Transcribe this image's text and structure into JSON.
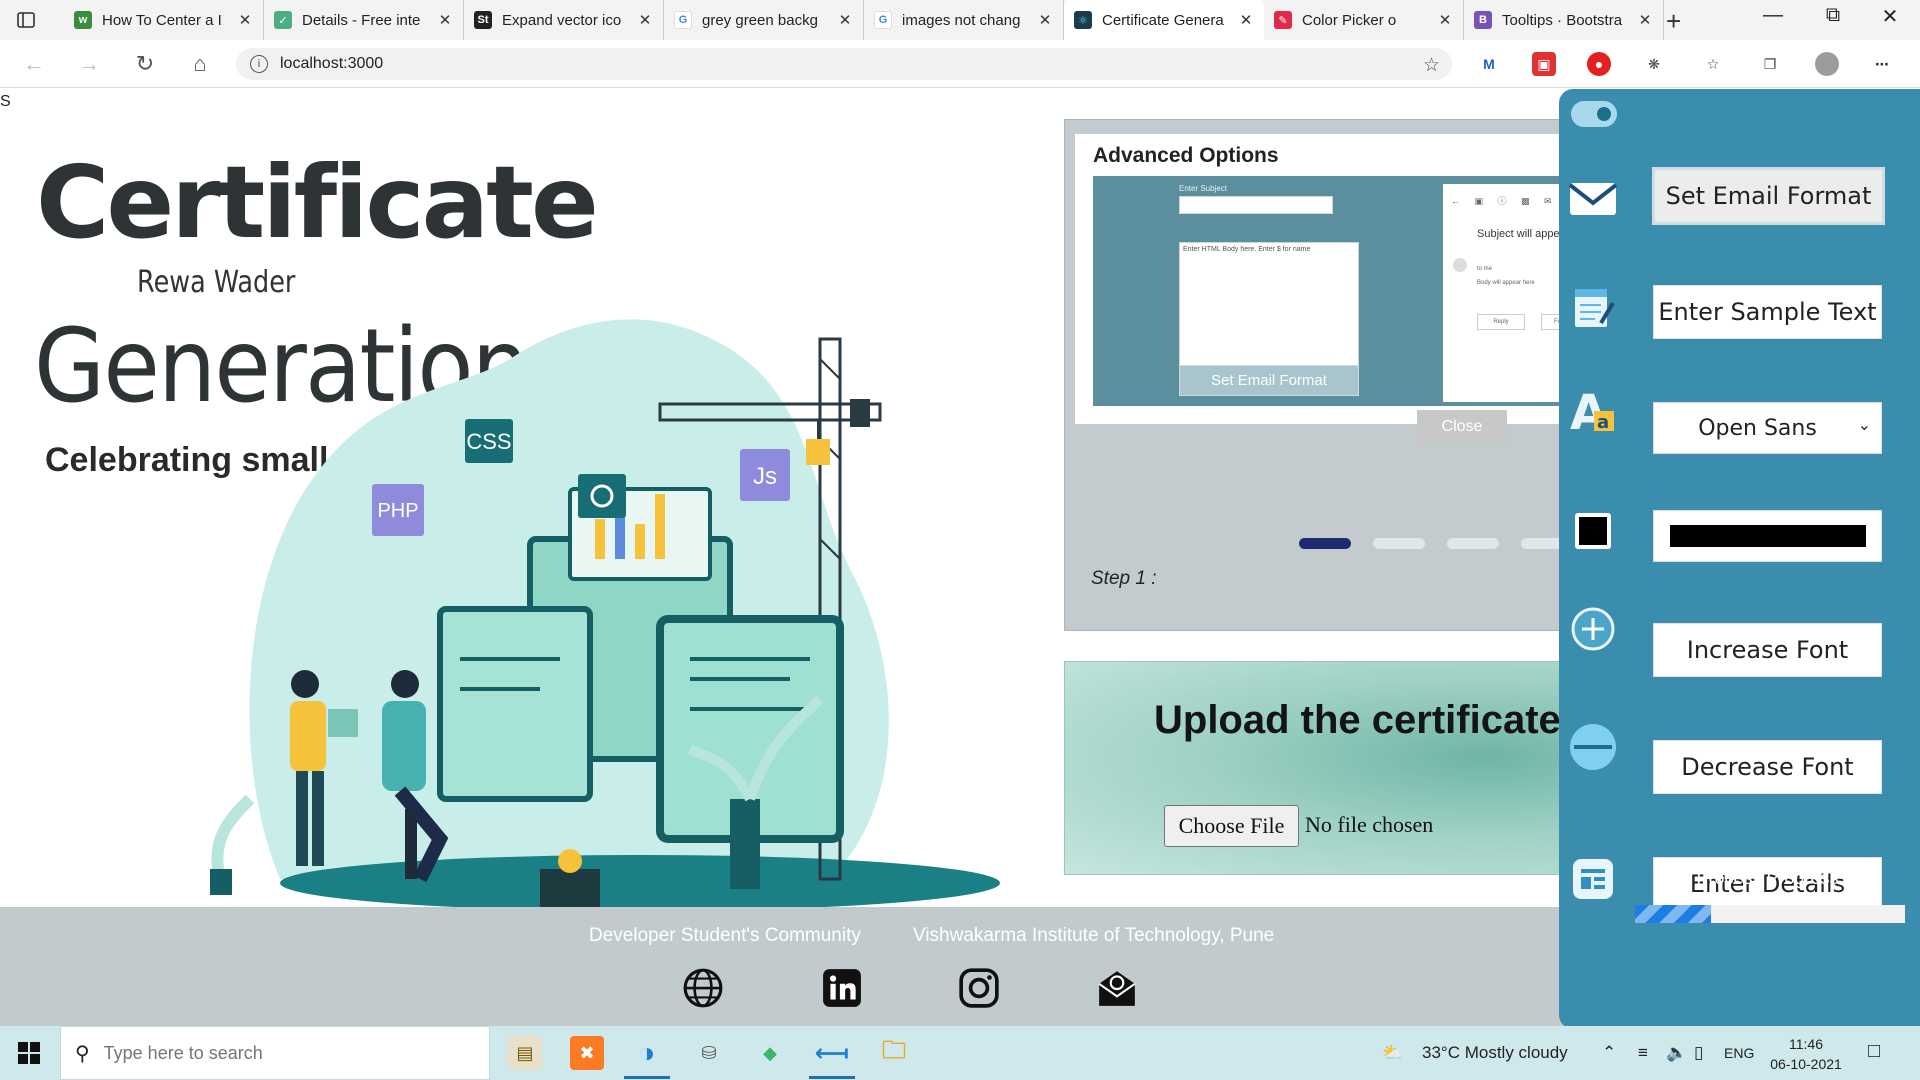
{
  "browser": {
    "tabs": [
      {
        "title": "How To Center a I",
        "favicon": "w",
        "color": "#3d8c3d"
      },
      {
        "title": "Details - Free inte",
        "favicon": "v",
        "color": "#4caf84"
      },
      {
        "title": "Expand vector ico",
        "favicon": "St",
        "color": "#222222"
      },
      {
        "title": "grey green backg",
        "favicon": "G",
        "color": "#ffffff"
      },
      {
        "title": "images not chang",
        "favicon": "G",
        "color": "#ffffff"
      },
      {
        "title": "Certificate Genera",
        "favicon": "react",
        "color": "#1b3a4b"
      },
      {
        "title": "Color Picker o",
        "favicon": "pick",
        "color": "#e0294a"
      },
      {
        "title": "Tooltips · Bootstra",
        "favicon": "B",
        "color": "#7952b3"
      }
    ],
    "url": "localhost:3000"
  },
  "page": {
    "stray_text": "S",
    "hero": {
      "title": "Certificate",
      "author": "Rewa Wader",
      "subtitle": "Generation",
      "tagline": "Celebrating small wins!",
      "illustration_labels": [
        "CSS",
        "PHP",
        "Js"
      ]
    },
    "carousel": {
      "slide_header": "Advanced Options",
      "mock_subject_label": "Enter Subject",
      "mock_body_placeholder": "Enter HTML Body here. Enter $ for name",
      "mock_button": "Set Email Format",
      "mock_mail_subject": "Subject will appear here",
      "mock_mail_to": "to me",
      "mock_mail_body": "Body will appear here",
      "mock_reply": "Reply",
      "mock_forward": "Forward",
      "close_label": "Close",
      "step_label": "Step 1 :",
      "active_dot": 0,
      "dot_count": 4
    },
    "upload": {
      "title": "Upload the certificate template",
      "choose_file_label": "Choose File",
      "file_status": "No file chosen"
    },
    "footer": {
      "community": "Developer Student's Community",
      "institute": "Vishwakarma Institute of Technology, Pune",
      "icons": [
        "globe-icon",
        "linkedin-icon",
        "instagram-icon",
        "email-icon"
      ]
    }
  },
  "side_panel": {
    "toggle_on": true,
    "buttons": {
      "set_email_format": "Set Email Format",
      "enter_sample_text": "Enter Sample Text",
      "increase_font": "Increase Font",
      "decrease_font": "Decrease Font",
      "enter_details": "Enter Details"
    },
    "font_select": "Open Sans",
    "text_color": "#000000",
    "progress_label": "Process Progress",
    "progress_fraction": 0.28
  },
  "taskbar": {
    "search_placeholder": "Type here to search",
    "weather": "33°C  Mostly cloudy",
    "language": "ENG",
    "time": "11:46",
    "date": "06-10-2021"
  }
}
